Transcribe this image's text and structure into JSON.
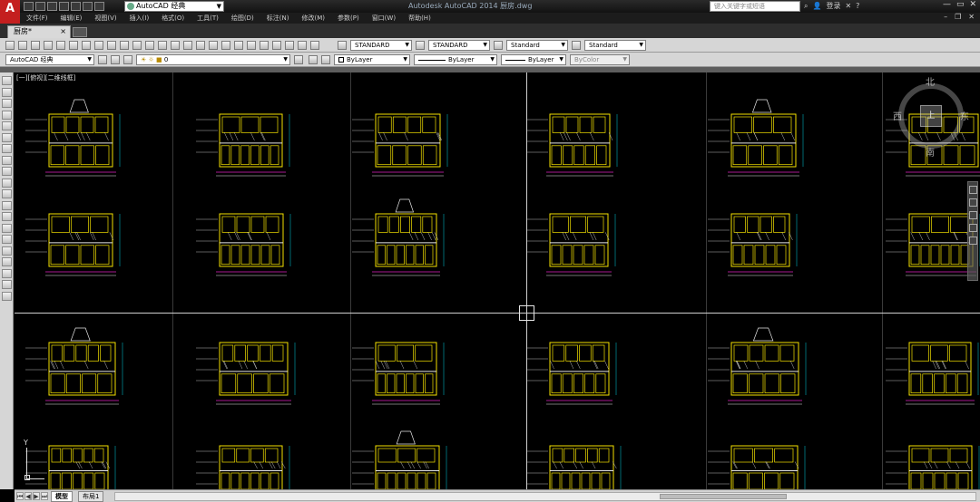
{
  "app": {
    "logo": "A",
    "workspace": "AutoCAD 经典",
    "title": "Autodesk AutoCAD 2014    厨房.dwg",
    "search_placeholder": "键入关键字或短语",
    "login": "登录",
    "help": "?"
  },
  "menu": [
    "文件(F)",
    "编辑(E)",
    "视图(V)",
    "插入(I)",
    "格式(O)",
    "工具(T)",
    "绘图(D)",
    "标注(N)",
    "修改(M)",
    "参数(P)",
    "窗口(W)",
    "帮助(H)"
  ],
  "document_tab": {
    "label": "厨房*",
    "close": "×"
  },
  "toolbar_styles": {
    "text_style": "STANDARD",
    "dim_style": "STANDARD",
    "table_style": "Standard",
    "mleader_style": "Standard"
  },
  "toolbar_props": {
    "workspace": "AutoCAD 经典",
    "layer": "0",
    "color": "ByLayer",
    "linetype": "ByLayer",
    "lineweight": "ByLayer",
    "plotstyle": "ByColor"
  },
  "viewport_label": "[一][俯视][二维线框]",
  "viewcube": {
    "north": "北",
    "west": "西",
    "east": "东",
    "south": "南",
    "face": "上"
  },
  "ucs": {
    "y": "Y"
  },
  "layout_tabs": [
    {
      "label": "模型",
      "active": true
    },
    {
      "label": "布局1",
      "active": false
    }
  ],
  "colors": {
    "canvas": "#000000",
    "cad_yellow": "#f4e100",
    "cad_white": "#e6e6e6",
    "cad_magenta": "#e020c0",
    "cad_cyan": "#00d0e0",
    "logo_red": "#c41f1f"
  }
}
